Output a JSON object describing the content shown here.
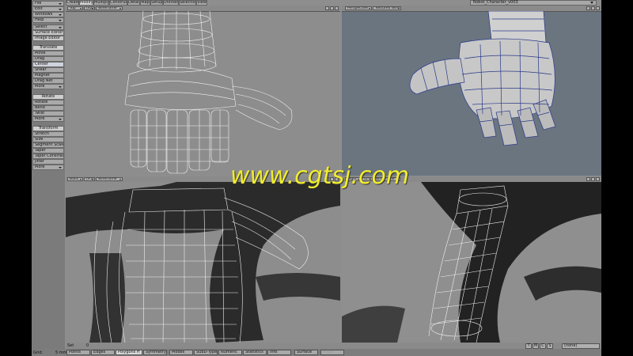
{
  "watermark": "www.cgtsj.com",
  "top_tabs": [
    "Create",
    "Modify",
    "Multiply",
    "Construct",
    "Detail",
    "Map",
    "Setup",
    "Utilities",
    "Selection",
    "View"
  ],
  "active_tab": "Modify",
  "scene_name": "Robot_Character_v003",
  "left_panel": {
    "file_menu": [
      "File",
      "Edit",
      "Windows",
      "Help"
    ],
    "misc": [
      "Select",
      "Surface Editor",
      "Image Editor"
    ],
    "translate_header": "Translate",
    "translate": [
      "Move",
      "Drag",
      "Center",
      "Shear",
      "Magnet",
      "Drag Net",
      "More"
    ],
    "rotate_header": "Rotate",
    "rotate": [
      "Rotate",
      "Bend",
      "Twist",
      "More"
    ],
    "transform_header": "Transform",
    "transform": [
      "Stretch",
      "Size",
      "Segment Scale",
      "Taper",
      "Taper Constrain",
      "Jitter",
      "More"
    ]
  },
  "viewports": {
    "top_left": {
      "view": "Top",
      "axis": "(XZ)",
      "mode": "Wireframe"
    },
    "top_right": {
      "view": "Perspective",
      "mode": "Textured Wire"
    },
    "bottom_left": {
      "view": "Back",
      "axis": "(XY)",
      "mode": "Wireframe"
    },
    "bottom_right": {
      "view": "Right",
      "axis": "(ZY)",
      "mode": "Wireframe"
    }
  },
  "status": {
    "set_label": "Set",
    "set_value": "0",
    "selection_mode": "(none)",
    "tsmc": [
      "T",
      "M",
      "C",
      "S"
    ]
  },
  "bottom_bar": {
    "grid_label": "Grid:",
    "grid_value": "5 mm",
    "buttons": [
      "Points",
      "Edges",
      "Polygons",
      "Symmetry",
      "Modes",
      "SubD-Type",
      "Numeric",
      "Statistics",
      "Info",
      "Surface",
      "Make"
    ],
    "active": "Polygons",
    "polygons_count": "H"
  },
  "colors": {
    "watermark": "#f2ee2c",
    "viewport_bg": "#8a8a8a",
    "perspective_bg": "#6a7580"
  }
}
